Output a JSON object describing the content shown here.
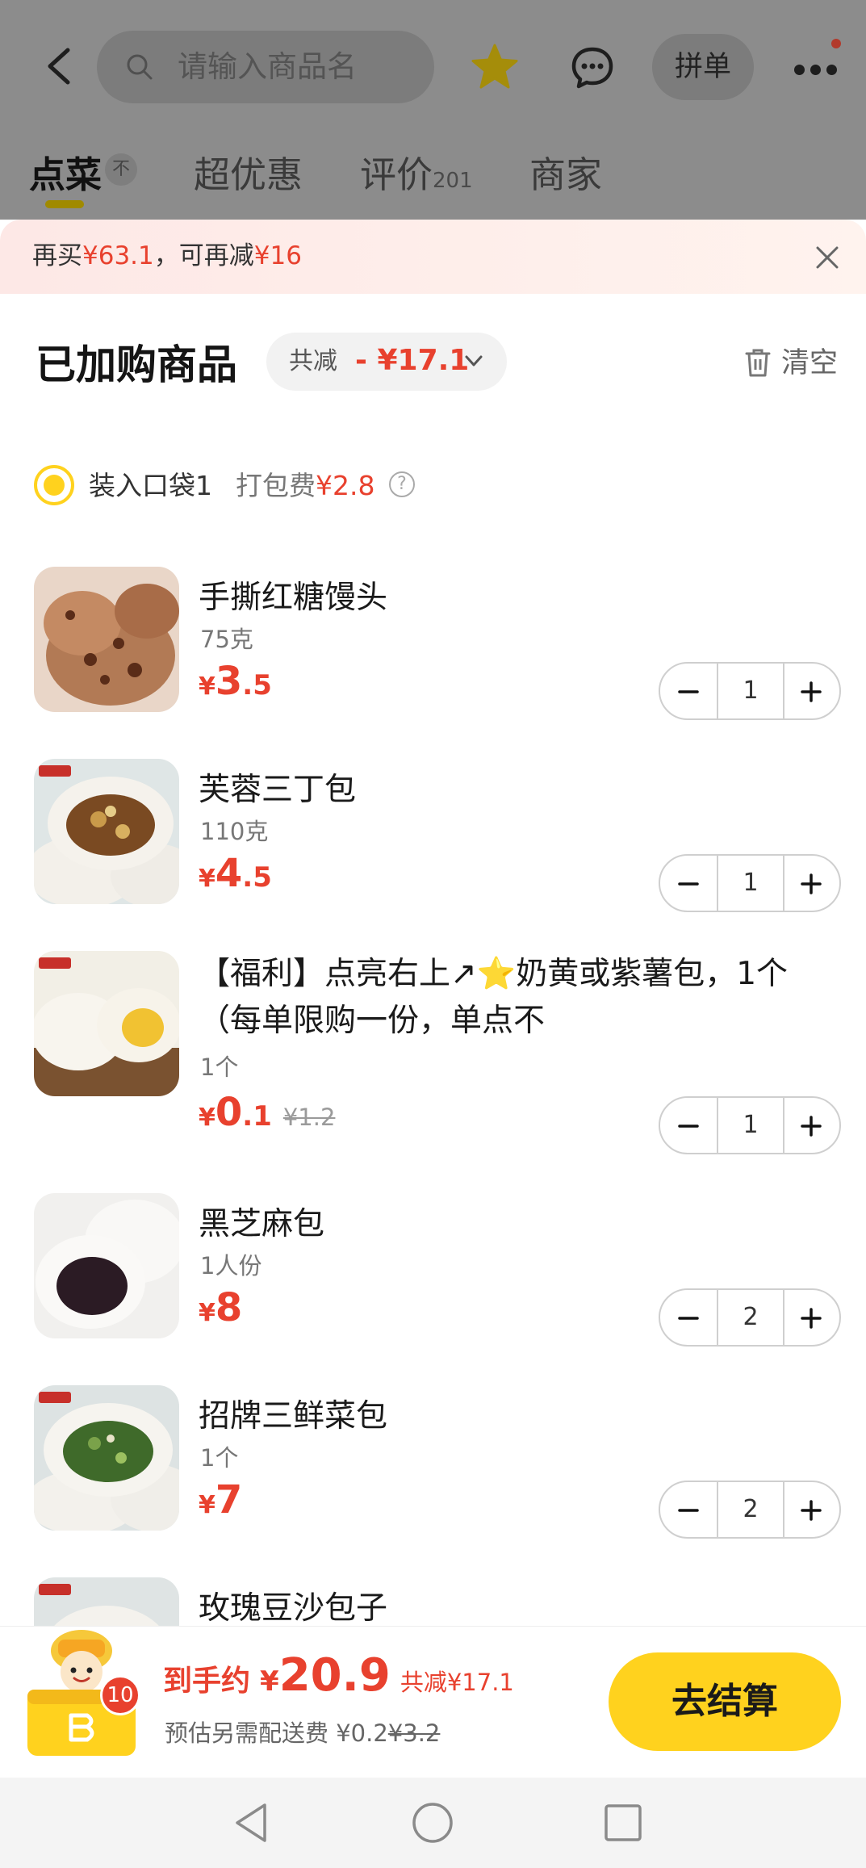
{
  "header": {
    "search_placeholder": "请输入商品名",
    "group_order_label": "拼单"
  },
  "tabs": [
    {
      "label": "点菜",
      "pin_label": "不"
    },
    {
      "label": "超优惠"
    },
    {
      "label": "评价",
      "count": "201"
    },
    {
      "label": "商家"
    }
  ],
  "promo": {
    "prefix": "再买",
    "amount": "¥63.1",
    "middle": "，可再减",
    "discount": "¥16"
  },
  "cart": {
    "title": "已加购商品",
    "total_discount_label": "共减",
    "total_discount_value": "- ¥17.1",
    "clear_label": "清空",
    "bag_name": "装入口袋1",
    "packing_fee_label": "打包费",
    "packing_fee_value": "¥2.8",
    "help_glyph": "?"
  },
  "items": [
    {
      "name": "手撕红糖馒头",
      "spec": "75克",
      "currency": "¥",
      "price_int": "3",
      "price_dec": ".5",
      "original_price": "",
      "qty": "1"
    },
    {
      "name": "芙蓉三丁包",
      "spec": "110克",
      "currency": "¥",
      "price_int": "4",
      "price_dec": ".5",
      "original_price": "",
      "qty": "1"
    },
    {
      "name": "【福利】点亮右上↗⭐奶黄或紫薯包，1个（每单限购一份，单点不",
      "spec": "1个",
      "currency": "¥",
      "price_int": "0",
      "price_dec": ".1",
      "original_price": "¥1.2",
      "qty": "1"
    },
    {
      "name": "黑芝麻包",
      "spec": "1人份",
      "currency": "¥",
      "price_int": "8",
      "price_dec": "",
      "original_price": "",
      "qty": "2"
    },
    {
      "name": "招牌三鲜菜包",
      "spec": "1个",
      "currency": "¥",
      "price_int": "7",
      "price_dec": "",
      "original_price": "",
      "qty": "2"
    },
    {
      "name": "玫瑰豆沙包子",
      "spec": "",
      "currency": "¥",
      "price_int": "",
      "price_dec": "",
      "original_price": "",
      "qty": ""
    }
  ],
  "checkout": {
    "cart_count": "10",
    "estimate_label": "到手约",
    "currency": "¥",
    "estimate_value": "20.9",
    "saved_label": "共减¥17.1",
    "shipping_label": "预估另需配送费",
    "shipping_value": "¥0.2",
    "shipping_original": "¥3.2",
    "checkout_label": "去结算"
  },
  "colors": {
    "accent_yellow": "#ffd21e",
    "price_red": "#e8412e"
  }
}
